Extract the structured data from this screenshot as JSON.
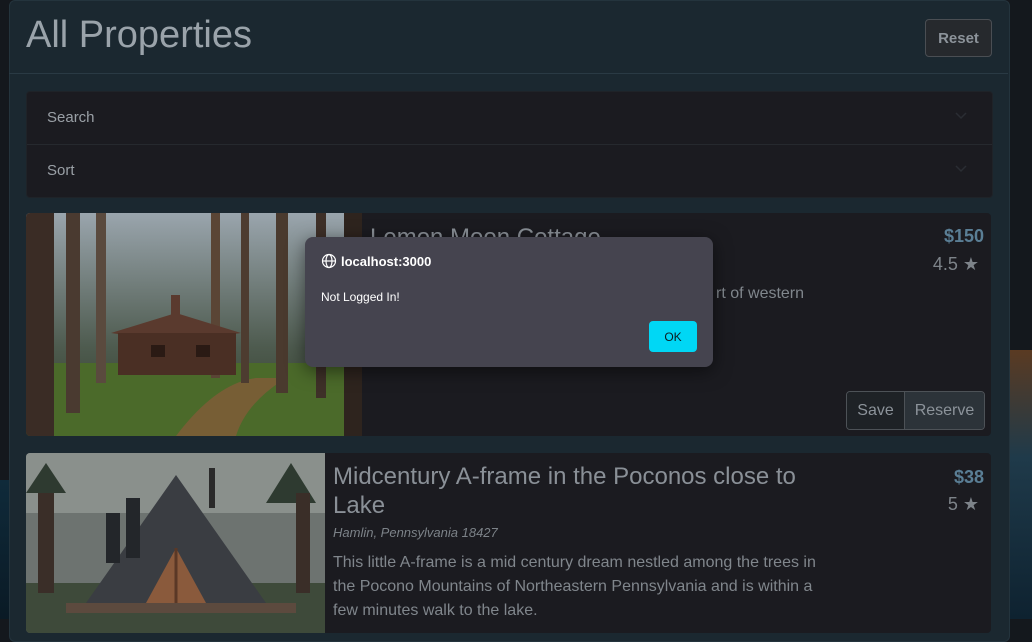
{
  "page": {
    "title": "All Properties",
    "reset_label": "Reset"
  },
  "filters": {
    "search_label": "Search",
    "sort_label": "Sort"
  },
  "properties": [
    {
      "title": "Lemon Moon Cottage",
      "description_fragment": "rt of western",
      "price": "$150",
      "rating": "4.5 ★",
      "save_label": "Save",
      "reserve_label": "Reserve"
    },
    {
      "title": "Midcentury A-frame in the Poconos close to Lake",
      "location": "Hamlin, Pennsylvania 18427",
      "description": "This little A-frame is a mid century dream nestled among the trees in the Pocono Mountains of Northeastern Pennsylvania and is within a few minutes walk to the lake.",
      "price": "$38",
      "rating": "5 ★"
    }
  ],
  "dialog": {
    "origin": "localhost:3000",
    "message": "Not Logged In!",
    "ok_label": "OK"
  },
  "colors": {
    "accent": "#00d7f5",
    "dialog_bg": "#45444f",
    "price": "#5a7e95"
  },
  "icons": {
    "dialog": "globe-icon",
    "accordion": "chevron-down-icon"
  }
}
